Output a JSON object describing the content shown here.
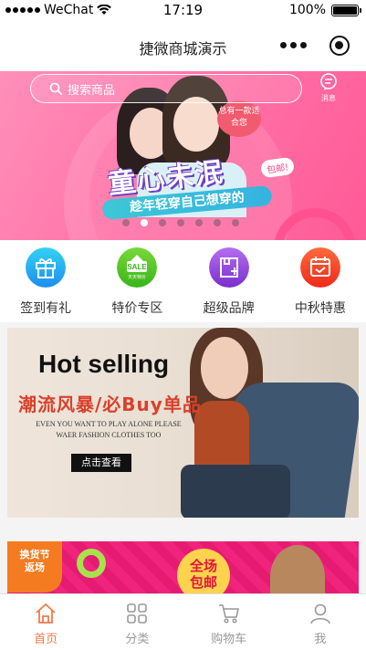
{
  "status_bar": {
    "carrier": "WeChat",
    "time": "17:19",
    "battery_percent": "100%",
    "battery_level": 1.0
  },
  "nav": {
    "title": "捷微商城演示"
  },
  "hero": {
    "search_placeholder": "搜索商品",
    "message_label": "消息",
    "title": "童心未泯",
    "tag": "包邮!",
    "bubble": "总有一款适合您",
    "subtitle": "趁年轻穿自己想穿的",
    "slide_count": 7,
    "active_slide": 1
  },
  "categories": [
    {
      "label": "签到有礼",
      "icon": "gift-icon",
      "color": "#2fb0f0"
    },
    {
      "label": "特价专区",
      "icon": "sale-tag-icon",
      "color": "#52c41a",
      "icon_text": "SALE",
      "icon_subtext": "天天特价"
    },
    {
      "label": "超级品牌",
      "icon": "brand-bag-icon",
      "color": "#8a3fd6"
    },
    {
      "label": "中秋特惠",
      "icon": "calendar-icon",
      "color": "#f24b26"
    }
  ],
  "promo": {
    "title": "Hot selling",
    "subtitle": "潮流风暴/必Buy单品",
    "english_line1": "EVEN YOU WANT TO PLAY ALONE PLEASE",
    "english_line2": "WAER FASHION CLOTHES TOO",
    "button_label": "点击查看"
  },
  "promo2": {
    "badge_line1": "换货节",
    "badge_line2": "返场",
    "circle_line1": "全场",
    "circle_line2": "包邮"
  },
  "tab_bar": [
    {
      "label": "首页",
      "icon": "home-icon",
      "active": true
    },
    {
      "label": "分类",
      "icon": "grid-icon",
      "active": false
    },
    {
      "label": "购物车",
      "icon": "cart-icon",
      "active": false
    },
    {
      "label": "我",
      "icon": "user-icon",
      "active": false
    }
  ],
  "colors": {
    "accent": "#f27a4a",
    "hero_pink": "#ff6fa5",
    "tab_inactive": "#999999"
  }
}
